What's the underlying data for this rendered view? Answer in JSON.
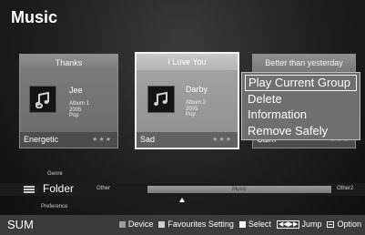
{
  "title": "Music",
  "cards": [
    {
      "song": "Thanks",
      "artist": "Jee",
      "album": "Album 1",
      "year": "2005",
      "genre": "Pop",
      "mood": "Energetic",
      "rating": "★★★"
    },
    {
      "song": "I Love You",
      "artist": "Darby",
      "album": "Album 2",
      "year": "2005",
      "genre": "Pop",
      "mood": "Sad",
      "rating": "★★★"
    },
    {
      "song": "Better than yesterday",
      "mood": "Calm",
      "rating": "★★★"
    }
  ],
  "menu": {
    "items": [
      "Play Current Group",
      "Delete",
      "Information",
      "Remove Safely"
    ],
    "selected_index": 0
  },
  "category_bar": {
    "above": "Genre",
    "current": "Folder",
    "below": "Preference",
    "left_item": "Other",
    "center_item": "Music",
    "right_item": "Other2"
  },
  "footer": {
    "brand": "SUM",
    "device": "Device",
    "favourites": "Favourites Setting",
    "select": "Select",
    "jump": "Jump",
    "jump_icon": "◀◀▶▶",
    "option": "Option"
  },
  "icons": {
    "note": "music-note-icon",
    "folder": "folder-icon",
    "option": "tools-icon"
  },
  "colors": {
    "background": "#1e1e1e",
    "card": "#7d7d7d",
    "card_focused_border": "#f2f2f2",
    "menu_bg": "#6f6f6f",
    "footer_bg": "#3b3b3b"
  }
}
